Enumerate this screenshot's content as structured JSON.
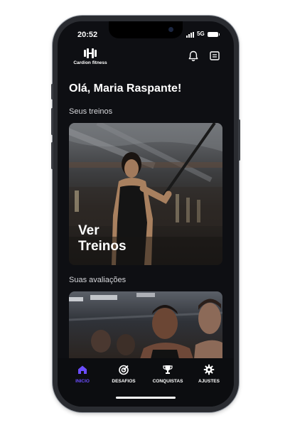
{
  "status": {
    "time": "20:52",
    "network": "5G"
  },
  "header": {
    "app_name": "Cardion fitness",
    "logo_icon": "dumbbell-icon",
    "notification_icon": "bell-icon",
    "messages_icon": "message-icon"
  },
  "main": {
    "greeting": "Olá, Maria Raspante!",
    "workouts": {
      "section_title": "Seus treinos",
      "card_title_line1": "Ver",
      "card_title_line2": "Treinos"
    },
    "assessments": {
      "section_title": "Suas avaliações"
    }
  },
  "tabs": [
    {
      "label": "INICIO",
      "icon": "home-icon",
      "active": true
    },
    {
      "label": "DESAFIOS",
      "icon": "target-icon",
      "active": false
    },
    {
      "label": "CONQUISTAS",
      "icon": "trophy-icon",
      "active": false
    },
    {
      "label": "AJUSTES",
      "icon": "gear-icon",
      "active": false
    }
  ],
  "colors": {
    "accent": "#6b4dff",
    "background": "#0e0f13",
    "text": "#ffffff"
  }
}
